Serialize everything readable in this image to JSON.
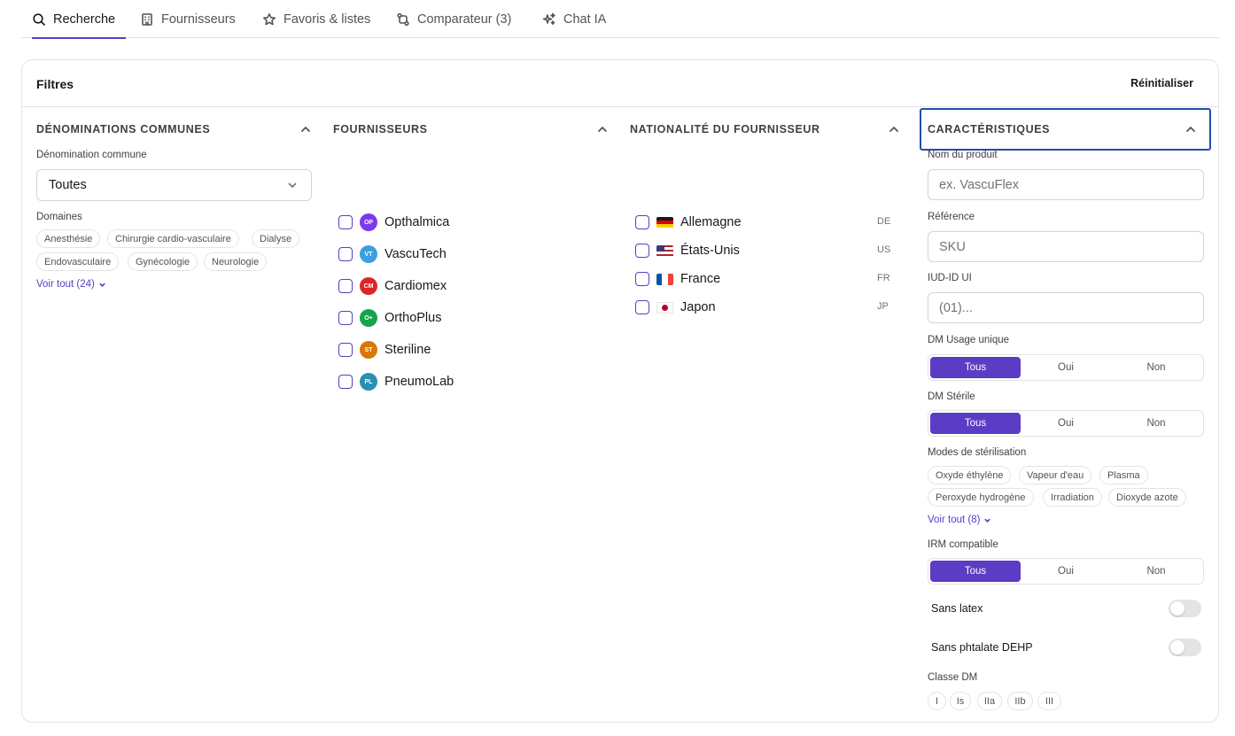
{
  "tabs": [
    {
      "label": "Recherche",
      "icon": "search-icon",
      "active": true
    },
    {
      "label": "Fournisseurs",
      "icon": "building-icon",
      "active": false
    },
    {
      "label": "Favoris & listes",
      "icon": "star-icon",
      "active": false
    },
    {
      "label": "Comparateur (3)",
      "icon": "compare-icon",
      "active": false
    },
    {
      "label": "Chat IA",
      "icon": "sparkles-icon",
      "active": false
    }
  ],
  "filters": {
    "title": "Filtres",
    "reset_label": "Réinitialiser",
    "denominations": {
      "title": "DÉNOMINATIONS COMMUNES",
      "field_label": "Dénomination commune",
      "selected": "Toutes",
      "domains_label": "Domaines",
      "domains": [
        "Anesthésie",
        "Chirurgie cardio-vasculaire",
        "Dialyse",
        "Endovasculaire",
        "Gynécologie",
        "Neurologie"
      ],
      "see_all": "Voir tout (24)"
    },
    "suppliers": {
      "title": "FOURNISSEURS",
      "items": [
        {
          "label": "Opthalmica",
          "initials": "OP",
          "color": "#7c3aed"
        },
        {
          "label": "VascuTech",
          "initials": "VT",
          "color": "#3b9fe0"
        },
        {
          "label": "Cardiomex",
          "initials": "CM",
          "color": "#dc2626"
        },
        {
          "label": "OrthoPlus",
          "initials": "O+",
          "color": "#16a34a"
        },
        {
          "label": "Steriline",
          "initials": "ST",
          "color": "#d97706"
        },
        {
          "label": "PneumoLab",
          "initials": "PL",
          "color": "#2a8fb0"
        }
      ]
    },
    "nationality": {
      "title": "NATIONALITÉ DU FOURNISSEUR",
      "items": [
        {
          "label": "Allemagne",
          "code": "DE"
        },
        {
          "label": "États-Unis",
          "code": "US"
        },
        {
          "label": "France",
          "code": "FR"
        },
        {
          "label": "Japon",
          "code": "JP"
        }
      ]
    },
    "characteristics": {
      "title": "CARACTÉRISTIQUES",
      "product_name_label": "Nom du produit",
      "product_name_placeholder": "ex. VascuFlex",
      "reference_label": "Référence",
      "reference_placeholder": "SKU",
      "udi_label": "IUD-ID UI",
      "udi_placeholder": "(01)...",
      "single_use": {
        "label": "DM Usage unique",
        "options": [
          "Tous",
          "Oui",
          "Non"
        ],
        "selected": "Tous"
      },
      "sterile": {
        "label": "DM Stérile",
        "options": [
          "Tous",
          "Oui",
          "Non"
        ],
        "selected": "Tous"
      },
      "sterilization_label": "Modes de stérilisation",
      "sterilization_modes": [
        "Oxyde éthylène",
        "Vapeur d'eau",
        "Plasma",
        "Peroxyde hydrogène",
        "Irradiation",
        "Dioxyde azote"
      ],
      "sterilization_see_all": "Voir tout (8)",
      "mri": {
        "label": "IRM compatible",
        "options": [
          "Tous",
          "Oui",
          "Non"
        ],
        "selected": "Tous"
      },
      "latex_free_label": "Sans latex",
      "dehp_free_label": "Sans phtalate DEHP",
      "class_label": "Classe DM",
      "classes": [
        "I",
        "Is",
        "IIa",
        "IIb",
        "III"
      ]
    }
  }
}
